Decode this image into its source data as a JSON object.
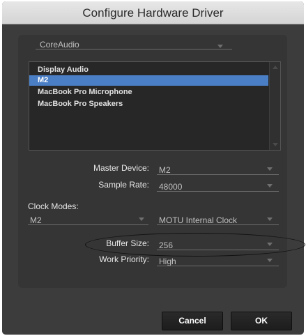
{
  "window": {
    "title": "Configure Hardware Driver"
  },
  "driver_select": {
    "value": "CoreAudio"
  },
  "device_list": {
    "items": [
      "Display Audio",
      "M2",
      "MacBook Pro Microphone",
      "MacBook Pro Speakers"
    ],
    "selected": "M2"
  },
  "master_device": {
    "label": "Master Device:",
    "value": "M2"
  },
  "sample_rate": {
    "label": "Sample Rate:",
    "value": "48000"
  },
  "clock_modes": {
    "label": "Clock Modes:",
    "device_value": "M2",
    "clock_value": "MOTU Internal Clock"
  },
  "buffer_size": {
    "label": "Buffer Size:",
    "value": "256"
  },
  "work_priority": {
    "label": "Work Priority:",
    "value": "High"
  },
  "buttons": {
    "cancel": "Cancel",
    "ok": "OK"
  },
  "colors": {
    "window_bg": "#3c3c3c",
    "panel_bg": "#353535",
    "selection": "#4a7fc6"
  },
  "icons": {
    "dropdown": "chevron-down-icon",
    "scroll_up": "scroll-up-arrow-icon",
    "scroll_down": "scroll-down-arrow-icon"
  }
}
